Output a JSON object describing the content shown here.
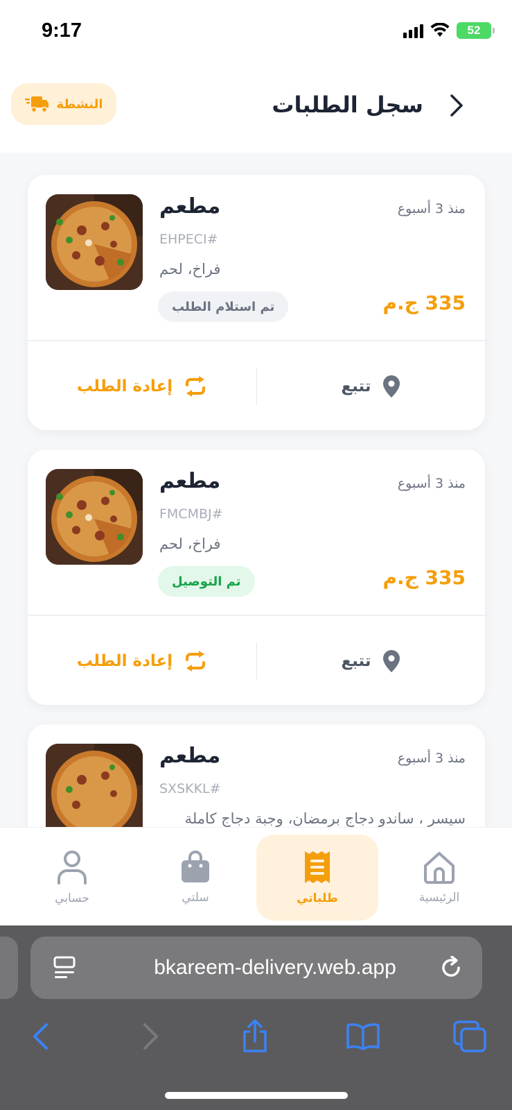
{
  "status_bar": {
    "time": "9:17",
    "battery": "52"
  },
  "header": {
    "title": "سجل الطلبات",
    "active_label": "النشطة"
  },
  "orders": [
    {
      "restaurant": "مطعم",
      "code": "EHPECI#",
      "items": "فراخ، لحم",
      "status": "تم استلام الطلب",
      "status_type": "received",
      "time_ago": "منذ 3 أسبوع",
      "price": "335 ج.م",
      "reorder_label": "إعادة الطلب",
      "track_label": "تتبع"
    },
    {
      "restaurant": "مطعم",
      "code": "FMCMBJ#",
      "items": "فراخ، لحم",
      "status": "تم التوصيل",
      "status_type": "delivered",
      "time_ago": "منذ 3 أسبوع",
      "price": "335 ج.م",
      "reorder_label": "إعادة الطلب",
      "track_label": "تتبع"
    },
    {
      "restaurant": "مطعم",
      "code": "SXSKKL#",
      "items": "سيسر ، ساندو دجاج برمضان، وجبة دجاج كاملة",
      "time_ago": "منذ 3 أسبوع"
    }
  ],
  "bottom_nav": [
    {
      "label": "حسابي",
      "icon": "user-icon",
      "active": false
    },
    {
      "label": "سلتي",
      "icon": "bag-icon",
      "active": false
    },
    {
      "label": "طلباتي",
      "icon": "receipt-icon",
      "active": true
    },
    {
      "label": "الرئيسية",
      "icon": "home-icon",
      "active": false
    }
  ],
  "browser": {
    "url": "bkareem-delivery.web.app"
  },
  "colors": {
    "accent": "#f59e0b",
    "success": "#16a34a",
    "muted": "#9ca3af"
  }
}
